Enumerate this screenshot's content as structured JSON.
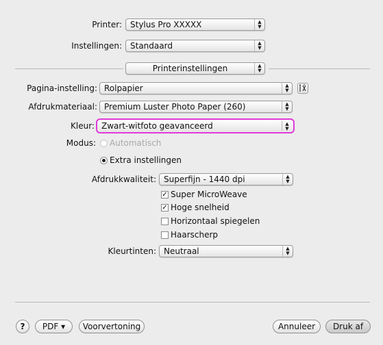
{
  "printer": {
    "label": "Printer:",
    "value": "Stylus Pro XXXXX"
  },
  "settings": {
    "label": "Instellingen:",
    "value": "Standaard"
  },
  "panel": {
    "value": "Printerinstellingen"
  },
  "page_setup": {
    "label": "Pagina-instelling:",
    "value": "Rolpapier"
  },
  "media": {
    "label": "Afdrukmateriaal:",
    "value": "Premium Luster Photo Paper (260)"
  },
  "color": {
    "label": "Kleur:",
    "value": "Zwart-witfoto geavanceerd",
    "highlight": "#e03ad8"
  },
  "mode": {
    "label": "Modus:",
    "auto_label": "Automatisch",
    "custom_label": "Extra instellingen",
    "selected": "Extra instellingen"
  },
  "quality": {
    "label": "Afdrukkwaliteit:",
    "value": "Superfijn - 1440 dpi"
  },
  "options": [
    {
      "label": "Super MicroWeave",
      "checked": true
    },
    {
      "label": "Hoge snelheid",
      "checked": true
    },
    {
      "label": "Horizontaal spiegelen",
      "checked": false
    },
    {
      "label": "Haarscherp",
      "checked": false
    }
  ],
  "tint": {
    "label": "Kleurtinten:",
    "value": "Neutraal"
  },
  "footer": {
    "help": "?",
    "pdf": "PDF ▾",
    "preview": "Voorvertoning",
    "cancel": "Annuleer",
    "print": "Druk af"
  },
  "icons": {
    "popup": "up-down-arrows-icon",
    "tool": "tools-icon",
    "check": "checkmark-icon",
    "radio": "radio-dot-icon"
  }
}
